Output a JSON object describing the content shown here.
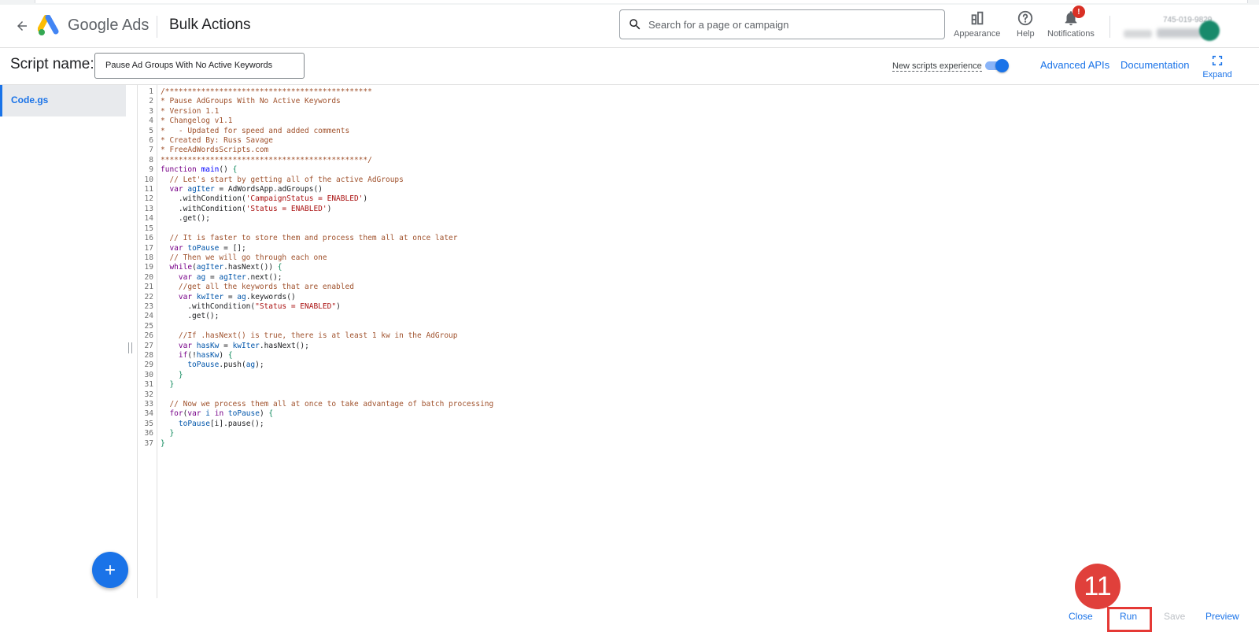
{
  "header": {
    "product_name": "Google Ads",
    "page_title": "Bulk Actions",
    "search_placeholder": "Search for a page or campaign",
    "appearance_label": "Appearance",
    "help_label": "Help",
    "notifications_label": "Notifications",
    "notifications_badge": "!",
    "account_number": "745-019-9829"
  },
  "scriptbar": {
    "script_name_label": "Script name:",
    "script_name_value": "Pause Ad Groups With No Active Keywords",
    "new_scripts_label": "New scripts experience",
    "new_scripts_enabled": true,
    "advanced_apis": "Advanced APIs",
    "documentation": "Documentation",
    "expand": "Expand"
  },
  "files": [
    {
      "name": "Code.gs",
      "active": true
    }
  ],
  "editor": {
    "line_numbers": [
      "1",
      "2",
      "3",
      "4",
      "5",
      "6",
      "7",
      "8",
      "9",
      "10",
      "11",
      "12",
      "13",
      "14",
      "15",
      "16",
      "17",
      "18",
      "19",
      "20",
      "21",
      "22",
      "23",
      "24",
      "25",
      "26",
      "27",
      "28",
      "29",
      "30",
      "31",
      "32",
      "33",
      "34",
      "35",
      "36",
      "37"
    ],
    "lines": [
      "/**********************************************",
      "* Pause AdGroups With No Active Keywords",
      "* Version 1.1",
      "* Changelog v1.1",
      "*   - Updated for speed and added comments",
      "* Created By: Russ Savage",
      "* FreeAdWordsScripts.com",
      "**********************************************/",
      "function main() {",
      "  // Let's start by getting all of the active AdGroups",
      "  var agIter = AdWordsApp.adGroups()",
      "    .withCondition('CampaignStatus = ENABLED')",
      "    .withCondition('Status = ENABLED')",
      "    .get();",
      "",
      "  // It is faster to store them and process them all at once later",
      "  var toPause = [];",
      "  // Then we will go through each one",
      "  while(agIter.hasNext()) {",
      "    var ag = agIter.next();",
      "    //get all the keywords that are enabled",
      "    var kwIter = ag.keywords()",
      "      .withCondition(\"Status = ENABLED\")",
      "      .get();",
      "",
      "    //If .hasNext() is true, there is at least 1 kw in the AdGroup",
      "    var hasKw = kwIter.hasNext();",
      "    if(!hasKw) {",
      "      toPause.push(ag);",
      "    }",
      "  }",
      "",
      "  // Now we process them all at once to take advantage of batch processing",
      "  for(var i in toPause) {",
      "    toPause[i].pause();",
      "  }",
      "}"
    ]
  },
  "bottombar": {
    "close": "Close",
    "run": "Run",
    "save": "Save",
    "preview": "Preview"
  },
  "annotation": {
    "step_number": "11"
  },
  "colors": {
    "accent": "#1a73e8",
    "annotation_red": "#e53935",
    "comment": "#a0522d",
    "keyword": "#770088",
    "string": "#aa1111"
  }
}
